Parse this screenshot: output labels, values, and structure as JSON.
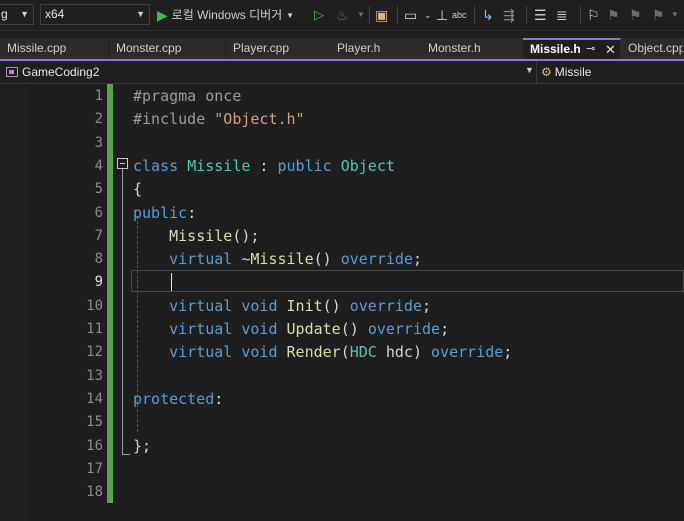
{
  "toolbar": {
    "config_value": "g",
    "platform_value": "x64",
    "run_label": "로컬 Windows 디버거"
  },
  "tabs": [
    {
      "label": "Missile.cpp",
      "active": false
    },
    {
      "label": "Monster.cpp",
      "active": false
    },
    {
      "label": "Player.cpp",
      "active": false
    },
    {
      "label": "Player.h",
      "active": false
    },
    {
      "label": "Monster.h",
      "active": false
    },
    {
      "label": "Missile.h",
      "active": true
    },
    {
      "label": "Object.cpp",
      "active": false
    }
  ],
  "nav": {
    "project": "GameCoding2",
    "scope": "Missile"
  },
  "editor": {
    "current_line": 9,
    "line_numbers": [
      "1",
      "2",
      "3",
      "4",
      "5",
      "6",
      "7",
      "8",
      "9",
      "10",
      "11",
      "12",
      "13",
      "14",
      "15",
      "16",
      "17",
      "18"
    ],
    "lines": [
      [
        {
          "c": "p",
          "t": "#pragma once"
        }
      ],
      [
        {
          "c": "p",
          "t": "#include "
        },
        {
          "c": "s",
          "t": "\"Object.h\""
        }
      ],
      [],
      [
        {
          "c": "k",
          "t": "class "
        },
        {
          "c": "t",
          "t": "Missile"
        },
        {
          "c": "d",
          "t": " : "
        },
        {
          "c": "k",
          "t": "public "
        },
        {
          "c": "t",
          "t": "Object"
        }
      ],
      [
        {
          "c": "d",
          "t": "{"
        }
      ],
      [
        {
          "c": "k",
          "t": "public"
        },
        {
          "c": "d",
          "t": ":"
        }
      ],
      [
        {
          "c": "d",
          "t": "    "
        },
        {
          "c": "f",
          "t": "Missile"
        },
        {
          "c": "d",
          "t": "();"
        }
      ],
      [
        {
          "c": "d",
          "t": "    "
        },
        {
          "c": "k",
          "t": "virtual "
        },
        {
          "c": "d",
          "t": "~"
        },
        {
          "c": "f",
          "t": "Missile"
        },
        {
          "c": "d",
          "t": "() "
        },
        {
          "c": "k",
          "t": "override"
        },
        {
          "c": "d",
          "t": ";"
        }
      ],
      [],
      [
        {
          "c": "d",
          "t": "    "
        },
        {
          "c": "k",
          "t": "virtual void "
        },
        {
          "c": "f",
          "t": "Init"
        },
        {
          "c": "d",
          "t": "() "
        },
        {
          "c": "k",
          "t": "override"
        },
        {
          "c": "d",
          "t": ";"
        }
      ],
      [
        {
          "c": "d",
          "t": "    "
        },
        {
          "c": "k",
          "t": "virtual void "
        },
        {
          "c": "f",
          "t": "Update"
        },
        {
          "c": "d",
          "t": "() "
        },
        {
          "c": "k",
          "t": "override"
        },
        {
          "c": "d",
          "t": ";"
        }
      ],
      [
        {
          "c": "d",
          "t": "    "
        },
        {
          "c": "k",
          "t": "virtual void "
        },
        {
          "c": "f",
          "t": "Render"
        },
        {
          "c": "d",
          "t": "("
        },
        {
          "c": "t",
          "t": "HDC"
        },
        {
          "c": "d",
          "t": " "
        },
        {
          "c": "pl",
          "t": "hdc"
        },
        {
          "c": "d",
          "t": ") "
        },
        {
          "c": "k",
          "t": "override"
        },
        {
          "c": "d",
          "t": ";"
        }
      ],
      [],
      [
        {
          "c": "k",
          "t": "protected"
        },
        {
          "c": "d",
          "t": ":"
        }
      ],
      [],
      [
        {
          "c": "d",
          "t": "};"
        }
      ],
      [],
      []
    ]
  }
}
